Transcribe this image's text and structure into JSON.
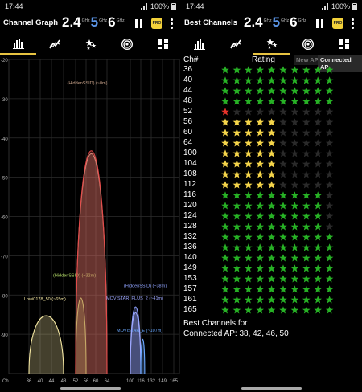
{
  "left": {
    "status": {
      "time": "17:44",
      "battery": "100%"
    },
    "title": "Channel Graph",
    "bands": [
      {
        "num": "2.4",
        "unit": "GHz"
      },
      {
        "num": "5",
        "unit": "GHz"
      },
      {
        "num": "6",
        "unit": "GHz"
      }
    ],
    "pro_label": "PRO",
    "tabs": [
      {
        "name": "tab-channel-graph",
        "icon": "bar-chart-icon",
        "active": true
      },
      {
        "name": "tab-time-graph",
        "icon": "line-graph-icon",
        "active": false
      },
      {
        "name": "tab-channel-rating",
        "icon": "stars-icon",
        "active": false
      },
      {
        "name": "tab-ap-list",
        "icon": "wifi-signal-icon",
        "active": false
      },
      {
        "name": "tab-dashboard",
        "icon": "dashboard-icon",
        "active": false
      }
    ],
    "chart_data": {
      "type": "area",
      "ylim": [
        -100,
        -20
      ],
      "yticks": [
        "-20",
        "-30",
        "-40",
        "-50",
        "-60",
        "-70",
        "-80",
        "-90"
      ],
      "xticks": [
        "Ch",
        "36",
        "40",
        "44",
        "48",
        "52",
        "56",
        "60",
        "64",
        "100",
        "116",
        "132",
        "149",
        "165"
      ],
      "grid": true,
      "networks": [
        {
          "label": "Lowi0178_50 (~65m)",
          "channel_from": 36,
          "channel_to": 48,
          "rssi": -82,
          "color": "#f3e6a1"
        },
        {
          "label": "(HiddenSSID) (~32m)",
          "channel_from": 52,
          "channel_to": 56,
          "rssi": -76,
          "color": "#b7e06a"
        },
        {
          "label": "(HiddenSSID) (~0m)",
          "channel_from": 52,
          "channel_to": 64,
          "rssi": -27,
          "color": "#c9a38a"
        },
        {
          "label": "",
          "channel_from": 52,
          "channel_to": 64,
          "rssi": -26,
          "color": "#e34848"
        },
        {
          "label": "(HiddenSSID) (~38m)",
          "channel_from": 100,
          "channel_to": 116,
          "rssi": -79,
          "color": "#8fa3ff"
        },
        {
          "label": "MOVISTAR_PLUS_2 (~41m)",
          "channel_from": 100,
          "channel_to": 116,
          "rssi": -81,
          "color": "#9fa8ff"
        },
        {
          "label": "MOVISTAR_E (~107m)",
          "channel_from": 116,
          "channel_to": 122,
          "rssi": -90,
          "color": "#6aa8ff"
        }
      ]
    }
  },
  "right": {
    "status": {
      "time": "17:44",
      "battery": "100%"
    },
    "title": "Best Channels",
    "bands": [
      {
        "num": "2.4",
        "unit": "GHz"
      },
      {
        "num": "5",
        "unit": "GHz"
      },
      {
        "num": "6",
        "unit": "GHz"
      }
    ],
    "pro_label": "PRO",
    "tabs": [
      {
        "name": "tab-channel-graph",
        "icon": "bar-chart-icon",
        "active": false
      },
      {
        "name": "tab-time-graph",
        "icon": "line-graph-icon",
        "active": false
      },
      {
        "name": "tab-channel-rating",
        "icon": "stars-icon",
        "active": true
      },
      {
        "name": "tab-ap-list",
        "icon": "wifi-signal-icon",
        "active": false
      },
      {
        "name": "tab-dashboard",
        "icon": "dashboard-icon",
        "active": false
      }
    ],
    "headers": {
      "ch": "Ch#",
      "rating": "Rating",
      "new_ap": "New AP",
      "connected_ap": "Connected AP"
    },
    "colors": {
      "green": "#27b125",
      "yellow": "#f5d54a",
      "red": "#e8332a",
      "empty": "#2a2a2a"
    },
    "channels": [
      {
        "ch": "36",
        "stars": 10,
        "color": "green"
      },
      {
        "ch": "40",
        "stars": 10,
        "color": "green"
      },
      {
        "ch": "44",
        "stars": 10,
        "color": "green"
      },
      {
        "ch": "48",
        "stars": 10,
        "color": "green"
      },
      {
        "ch": "52",
        "stars": 1,
        "color": "red"
      },
      {
        "ch": "56",
        "stars": 5,
        "color": "yellow"
      },
      {
        "ch": "60",
        "stars": 5,
        "color": "yellow"
      },
      {
        "ch": "64",
        "stars": 5,
        "color": "yellow"
      },
      {
        "ch": "100",
        "stars": 5,
        "color": "yellow"
      },
      {
        "ch": "104",
        "stars": 5,
        "color": "yellow"
      },
      {
        "ch": "108",
        "stars": 5,
        "color": "yellow"
      },
      {
        "ch": "112",
        "stars": 5,
        "color": "yellow"
      },
      {
        "ch": "116",
        "stars": 9,
        "color": "green"
      },
      {
        "ch": "120",
        "stars": 9,
        "color": "green"
      },
      {
        "ch": "124",
        "stars": 9,
        "color": "green"
      },
      {
        "ch": "128",
        "stars": 9,
        "color": "green"
      },
      {
        "ch": "132",
        "stars": 10,
        "color": "green"
      },
      {
        "ch": "136",
        "stars": 10,
        "color": "green"
      },
      {
        "ch": "140",
        "stars": 10,
        "color": "green"
      },
      {
        "ch": "149",
        "stars": 10,
        "color": "green"
      },
      {
        "ch": "153",
        "stars": 10,
        "color": "green"
      },
      {
        "ch": "157",
        "stars": 10,
        "color": "green"
      },
      {
        "ch": "161",
        "stars": 10,
        "color": "green"
      },
      {
        "ch": "165",
        "stars": 10,
        "color": "green"
      }
    ],
    "best_line1": "Best Channels for",
    "best_line2": "Connected AP: 38, 42, 46, 50"
  }
}
